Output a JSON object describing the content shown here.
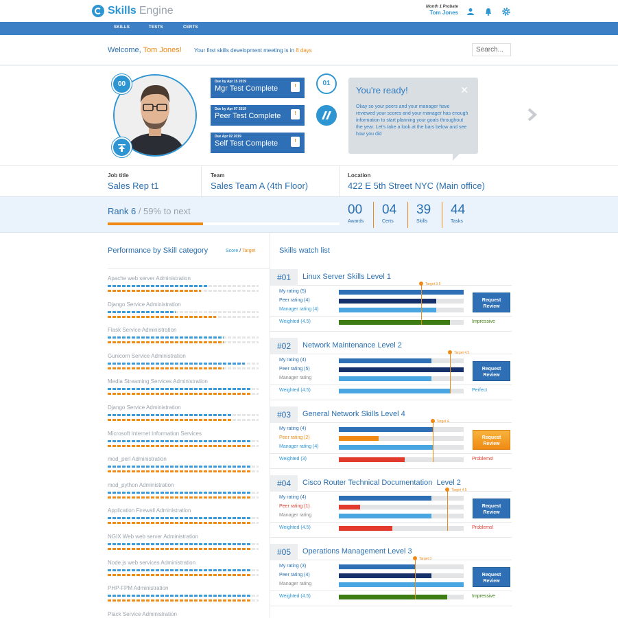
{
  "header": {
    "brand_part1": "Skills",
    "brand_part2": "Engine",
    "user_subtitle": "Month 1 Probate",
    "user_name": "Tom Jones"
  },
  "nav": [
    "SKILLS",
    "TESTS",
    "CERTS"
  ],
  "welcome": {
    "prefix": "Welcome,",
    "name": "Tom Jones!",
    "meeting_text": "Your first skills development meeting is in",
    "meeting_days": "8 days",
    "search_placeholder": "Search..."
  },
  "profile": {
    "awards_badge": "00",
    "badge_01": "01"
  },
  "tests": [
    {
      "due": "Due by Apr 15 2019",
      "title": "Mgr Test Complete",
      "flag": "!"
    },
    {
      "due": "Due by Apr 07 2019",
      "title": "Peer Test Complete",
      "flag": "!"
    },
    {
      "due": "Due Apr 02 2019",
      "title": "Self Test Complete",
      "flag": "!"
    }
  ],
  "bubble": {
    "title": "You're ready!",
    "text": "Okay so your peers and your manager have reviewed your scores and your manager has enough information to start planning your goals throughout the year. Let's take a look at the bars below and see how you did"
  },
  "info": {
    "job_label": "Job title",
    "job_value": "Sales Rep t1",
    "team_label": "Team",
    "team_value": "Sales Team A (4th Floor)",
    "location_label": "Location",
    "location_value": "422 E 5th Street NYC (Main office)"
  },
  "rank": {
    "label": "Rank 6",
    "next": "/ 59% to next",
    "progress": 0.41
  },
  "stats": [
    {
      "num": "00",
      "label": "Awards"
    },
    {
      "num": "04",
      "label": "Certs"
    },
    {
      "num": "39",
      "label": "Skills"
    },
    {
      "num": "44",
      "label": "Tasks"
    }
  ],
  "performance": {
    "title": "Performance by Skill category",
    "legend_score": "Score",
    "legend_sep": "/",
    "legend_target": "Target",
    "items": [
      {
        "name": "Apache web server Administration",
        "score": 0.67,
        "target": 0.62
      },
      {
        "name": "Django Service Administration",
        "score": 0.45,
        "target": 0.72
      },
      {
        "name": "Flask Service Administration",
        "score": 0.77,
        "target": 0.77
      },
      {
        "name": "Gunicorn Service Administration",
        "score": 0.91,
        "target": 0.77
      },
      {
        "name": "Media Streaming Services Administration",
        "score": 0.95,
        "target": 0.95
      },
      {
        "name": "Django Service Administration",
        "score": 0.82,
        "target": 0.82
      },
      {
        "name": "Microsoft Internet Information Services",
        "score": 0.95,
        "target": 0.95
      },
      {
        "name": "mod_perl Administration",
        "score": 0.95,
        "target": 0.95
      },
      {
        "name": "mod_python Administration",
        "score": 0.95,
        "target": 0.95
      },
      {
        "name": "Application Firewall Administration",
        "score": 0.95,
        "target": 0.95
      },
      {
        "name": "NGIX Web web server Administration",
        "score": 0.95,
        "target": 0.95
      },
      {
        "name": "Node.js web services Administration",
        "score": 0.95,
        "target": 0.95
      },
      {
        "name": "PHP-FPM Administration",
        "score": 0.95,
        "target": 0.95
      },
      {
        "name": "Plack Service Administration",
        "score": 0.95,
        "target": 0.95
      }
    ]
  },
  "watchlist": {
    "title": "Skills watch list",
    "items": [
      {
        "num": "#01",
        "title": "Linux Server Skills Level 1",
        "target_label": "Target 3.5",
        "target": 0.66,
        "rows": [
          {
            "label": "My rating (5)",
            "value": 1.0,
            "color": "#2e6fb5",
            "label_color": "#2a6fb0"
          },
          {
            "label": "Peer rating (4)",
            "value": 0.78,
            "color": "#15306a",
            "label_color": "#2a6fb0"
          },
          {
            "label": "Manager rating (4)",
            "value": 0.78,
            "color": "#4aa6e0",
            "label_color": "#2e95d3"
          }
        ],
        "weighted_label": "Weighted (4.5)",
        "weighted": 0.89,
        "weighted_color": "#3d7d13",
        "verdict": "Impressive",
        "verdict_color": "#3d7d13",
        "button": "Request Review",
        "button_style": "blue"
      },
      {
        "num": "#02",
        "title": "Network Maintenance Level 2",
        "target_label": "Target 4.5",
        "target": 0.89,
        "rows": [
          {
            "label": "My rating (4)",
            "value": 0.74,
            "color": "#2e6fb5",
            "label_color": "#2a6fb0"
          },
          {
            "label": "Peer rating (5)",
            "value": 1.0,
            "color": "#15306a",
            "label_color": "#2a6fb0"
          },
          {
            "label": "Manager rating",
            "value": 0.74,
            "color": "#4aa6e0",
            "label_color": "#888"
          }
        ],
        "weighted_label": "Weighted (4.5)",
        "weighted": 0.89,
        "weighted_color": "#4aa6e0",
        "verdict": "Perfect",
        "verdict_color": "#2e95d3",
        "button": "Request Review",
        "button_style": "blue"
      },
      {
        "num": "#03",
        "title": "General Network Skills Level 4",
        "target_label": "Target 4",
        "target": 0.75,
        "rows": [
          {
            "label": "My rating (4)",
            "value": 0.75,
            "color": "#2e6fb5",
            "label_color": "#2a6fb0"
          },
          {
            "label": "Peer rating (2)",
            "value": 0.32,
            "color": "#ef8a14",
            "label_color": "#ef8a14"
          },
          {
            "label": "Manager rating (4)",
            "value": 0.75,
            "color": "#4aa6e0",
            "label_color": "#2e95d3"
          }
        ],
        "weighted_label": "Weighted (3)",
        "weighted": 0.53,
        "weighted_color": "#e23b2e",
        "verdict": "Problems!",
        "verdict_color": "#e23b2e",
        "button": "Request Review",
        "button_style": "orange"
      },
      {
        "num": "#04",
        "title": "Cisco Router Technical Documentation  Level 2",
        "target_label": "Target 4.5",
        "target": 0.87,
        "rows": [
          {
            "label": "My rating (4)",
            "value": 0.74,
            "color": "#2e6fb5",
            "label_color": "#2a6fb0"
          },
          {
            "label": "Peer rating (1)",
            "value": 0.17,
            "color": "#e23b2e",
            "label_color": "#e23b2e"
          },
          {
            "label": "Manager rating",
            "value": 0.74,
            "color": "#4aa6e0",
            "label_color": "#888"
          }
        ],
        "weighted_label": "Weighted (4.5)",
        "weighted": 0.43,
        "weighted_color": "#e23b2e",
        "verdict": "Problems!",
        "verdict_color": "#e23b2e",
        "button": "Request Review",
        "button_style": "blue"
      },
      {
        "num": "#05",
        "title": "Operations Management Level 3",
        "target_label": "Target 3",
        "target": 0.61,
        "rows": [
          {
            "label": "My rating (3)",
            "value": 0.61,
            "color": "#2e6fb5",
            "label_color": "#2a6fb0"
          },
          {
            "label": "Peer rating (4)",
            "value": 0.74,
            "color": "#15306a",
            "label_color": "#2a6fb0"
          },
          {
            "label": "Manager rating",
            "value": 1.0,
            "color": "#4aa6e0",
            "label_color": "#888"
          }
        ],
        "weighted_label": "Weighted (4.5)",
        "weighted": 0.87,
        "weighted_color": "#3d7d13",
        "verdict": "Impressive",
        "verdict_color": "#3d7d13",
        "button": "Request Review",
        "button_style": "blue"
      }
    ]
  }
}
